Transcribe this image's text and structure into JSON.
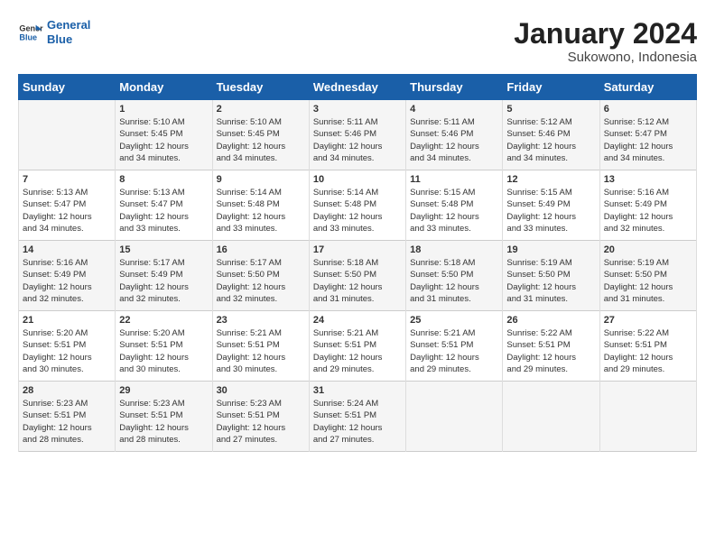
{
  "logo": {
    "line1": "General",
    "line2": "Blue"
  },
  "title": "January 2024",
  "subtitle": "Sukowono, Indonesia",
  "days_header": [
    "Sunday",
    "Monday",
    "Tuesday",
    "Wednesday",
    "Thursday",
    "Friday",
    "Saturday"
  ],
  "weeks": [
    [
      {
        "day": "",
        "info": ""
      },
      {
        "day": "1",
        "info": "Sunrise: 5:10 AM\nSunset: 5:45 PM\nDaylight: 12 hours\nand 34 minutes."
      },
      {
        "day": "2",
        "info": "Sunrise: 5:10 AM\nSunset: 5:45 PM\nDaylight: 12 hours\nand 34 minutes."
      },
      {
        "day": "3",
        "info": "Sunrise: 5:11 AM\nSunset: 5:46 PM\nDaylight: 12 hours\nand 34 minutes."
      },
      {
        "day": "4",
        "info": "Sunrise: 5:11 AM\nSunset: 5:46 PM\nDaylight: 12 hours\nand 34 minutes."
      },
      {
        "day": "5",
        "info": "Sunrise: 5:12 AM\nSunset: 5:46 PM\nDaylight: 12 hours\nand 34 minutes."
      },
      {
        "day": "6",
        "info": "Sunrise: 5:12 AM\nSunset: 5:47 PM\nDaylight: 12 hours\nand 34 minutes."
      }
    ],
    [
      {
        "day": "7",
        "info": "Sunrise: 5:13 AM\nSunset: 5:47 PM\nDaylight: 12 hours\nand 34 minutes."
      },
      {
        "day": "8",
        "info": "Sunrise: 5:13 AM\nSunset: 5:47 PM\nDaylight: 12 hours\nand 33 minutes."
      },
      {
        "day": "9",
        "info": "Sunrise: 5:14 AM\nSunset: 5:48 PM\nDaylight: 12 hours\nand 33 minutes."
      },
      {
        "day": "10",
        "info": "Sunrise: 5:14 AM\nSunset: 5:48 PM\nDaylight: 12 hours\nand 33 minutes."
      },
      {
        "day": "11",
        "info": "Sunrise: 5:15 AM\nSunset: 5:48 PM\nDaylight: 12 hours\nand 33 minutes."
      },
      {
        "day": "12",
        "info": "Sunrise: 5:15 AM\nSunset: 5:49 PM\nDaylight: 12 hours\nand 33 minutes."
      },
      {
        "day": "13",
        "info": "Sunrise: 5:16 AM\nSunset: 5:49 PM\nDaylight: 12 hours\nand 32 minutes."
      }
    ],
    [
      {
        "day": "14",
        "info": "Sunrise: 5:16 AM\nSunset: 5:49 PM\nDaylight: 12 hours\nand 32 minutes."
      },
      {
        "day": "15",
        "info": "Sunrise: 5:17 AM\nSunset: 5:49 PM\nDaylight: 12 hours\nand 32 minutes."
      },
      {
        "day": "16",
        "info": "Sunrise: 5:17 AM\nSunset: 5:50 PM\nDaylight: 12 hours\nand 32 minutes."
      },
      {
        "day": "17",
        "info": "Sunrise: 5:18 AM\nSunset: 5:50 PM\nDaylight: 12 hours\nand 31 minutes."
      },
      {
        "day": "18",
        "info": "Sunrise: 5:18 AM\nSunset: 5:50 PM\nDaylight: 12 hours\nand 31 minutes."
      },
      {
        "day": "19",
        "info": "Sunrise: 5:19 AM\nSunset: 5:50 PM\nDaylight: 12 hours\nand 31 minutes."
      },
      {
        "day": "20",
        "info": "Sunrise: 5:19 AM\nSunset: 5:50 PM\nDaylight: 12 hours\nand 31 minutes."
      }
    ],
    [
      {
        "day": "21",
        "info": "Sunrise: 5:20 AM\nSunset: 5:51 PM\nDaylight: 12 hours\nand 30 minutes."
      },
      {
        "day": "22",
        "info": "Sunrise: 5:20 AM\nSunset: 5:51 PM\nDaylight: 12 hours\nand 30 minutes."
      },
      {
        "day": "23",
        "info": "Sunrise: 5:21 AM\nSunset: 5:51 PM\nDaylight: 12 hours\nand 30 minutes."
      },
      {
        "day": "24",
        "info": "Sunrise: 5:21 AM\nSunset: 5:51 PM\nDaylight: 12 hours\nand 29 minutes."
      },
      {
        "day": "25",
        "info": "Sunrise: 5:21 AM\nSunset: 5:51 PM\nDaylight: 12 hours\nand 29 minutes."
      },
      {
        "day": "26",
        "info": "Sunrise: 5:22 AM\nSunset: 5:51 PM\nDaylight: 12 hours\nand 29 minutes."
      },
      {
        "day": "27",
        "info": "Sunrise: 5:22 AM\nSunset: 5:51 PM\nDaylight: 12 hours\nand 29 minutes."
      }
    ],
    [
      {
        "day": "28",
        "info": "Sunrise: 5:23 AM\nSunset: 5:51 PM\nDaylight: 12 hours\nand 28 minutes."
      },
      {
        "day": "29",
        "info": "Sunrise: 5:23 AM\nSunset: 5:51 PM\nDaylight: 12 hours\nand 28 minutes."
      },
      {
        "day": "30",
        "info": "Sunrise: 5:23 AM\nSunset: 5:51 PM\nDaylight: 12 hours\nand 27 minutes."
      },
      {
        "day": "31",
        "info": "Sunrise: 5:24 AM\nSunset: 5:51 PM\nDaylight: 12 hours\nand 27 minutes."
      },
      {
        "day": "",
        "info": ""
      },
      {
        "day": "",
        "info": ""
      },
      {
        "day": "",
        "info": ""
      }
    ]
  ]
}
